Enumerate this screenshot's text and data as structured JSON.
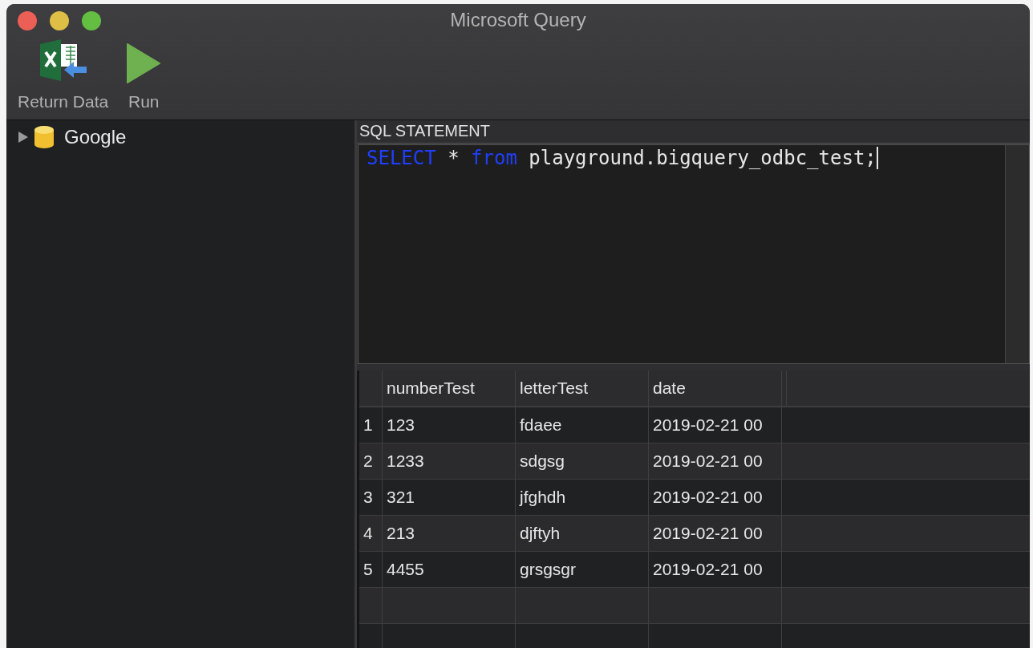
{
  "window": {
    "title": "Microsoft Query"
  },
  "toolbar": [
    {
      "label": "Return Data",
      "kind": "excel"
    },
    {
      "label": "Run",
      "kind": "run"
    }
  ],
  "tree": [
    {
      "label": "Google",
      "expanded": false
    }
  ],
  "sql_section": {
    "title": "SQL STATEMENT",
    "tokens": [
      {
        "text": "SELECT",
        "kind": "keyword"
      },
      {
        "text": "*",
        "kind": "plain"
      },
      {
        "text": "from",
        "kind": "keyword"
      },
      {
        "text": "playground.bigquery_odbc_test;",
        "kind": "plain"
      }
    ]
  },
  "table": {
    "columns": [
      "numberTest",
      "letterTest",
      "date"
    ],
    "rows": [
      {
        "index": "1",
        "cells": [
          "123",
          "fdaee",
          "2019-02-21 00"
        ]
      },
      {
        "index": "2",
        "cells": [
          "1233",
          "sdgsg",
          "2019-02-21 00"
        ]
      },
      {
        "index": "3",
        "cells": [
          "321",
          "jfghdh",
          "2019-02-21 00"
        ]
      },
      {
        "index": "4",
        "cells": [
          "213",
          "djftyh",
          "2019-02-21 00"
        ]
      },
      {
        "index": "5",
        "cells": [
          "4455",
          "grsgsgr",
          "2019-02-21 00"
        ]
      }
    ]
  }
}
